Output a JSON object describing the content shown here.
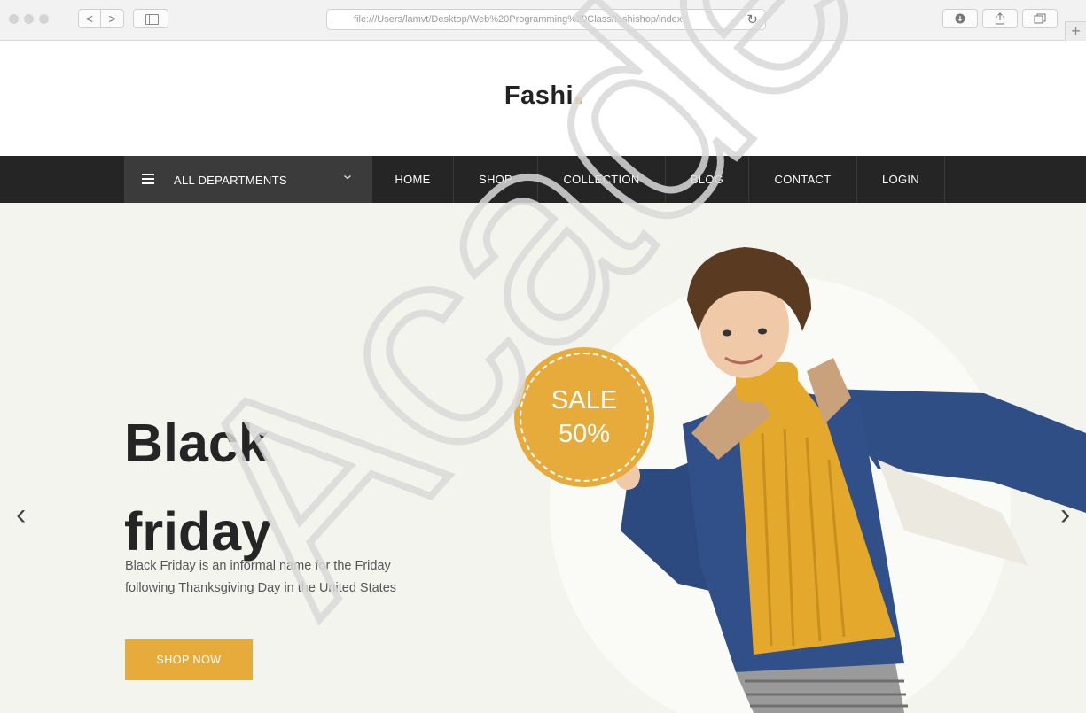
{
  "browser": {
    "back": "<",
    "forward": ">",
    "url": "file:///Users/lamvt/Desktop/Web%20Programming%20Class/fashishop/index",
    "reload": "↻",
    "new_tab": "+"
  },
  "logo": {
    "text": "Fashi"
  },
  "nav": {
    "departments_label": "ALL DEPARTMENTS",
    "items": [
      "HOME",
      "SHOP",
      "COLLECTION",
      "BLOG",
      "CONTACT",
      "LOGIN"
    ]
  },
  "hero": {
    "title_line1": "Black",
    "title_line2": "friday",
    "description_line1": "Black Friday is an informal name for the Friday",
    "description_line2": "following Thanksgiving Day in the United States",
    "button": "SHOP NOW",
    "sale_line1": "SALE",
    "sale_line2": "50%",
    "prev_arrow": "‹",
    "next_arrow": "›"
  },
  "watermark": {
    "text": "Academy"
  },
  "colors": {
    "accent": "#e7ab3c",
    "nav_bg": "#252525",
    "dept_bg": "#3b3b3b",
    "hero_bg": "#f4f4ef"
  }
}
